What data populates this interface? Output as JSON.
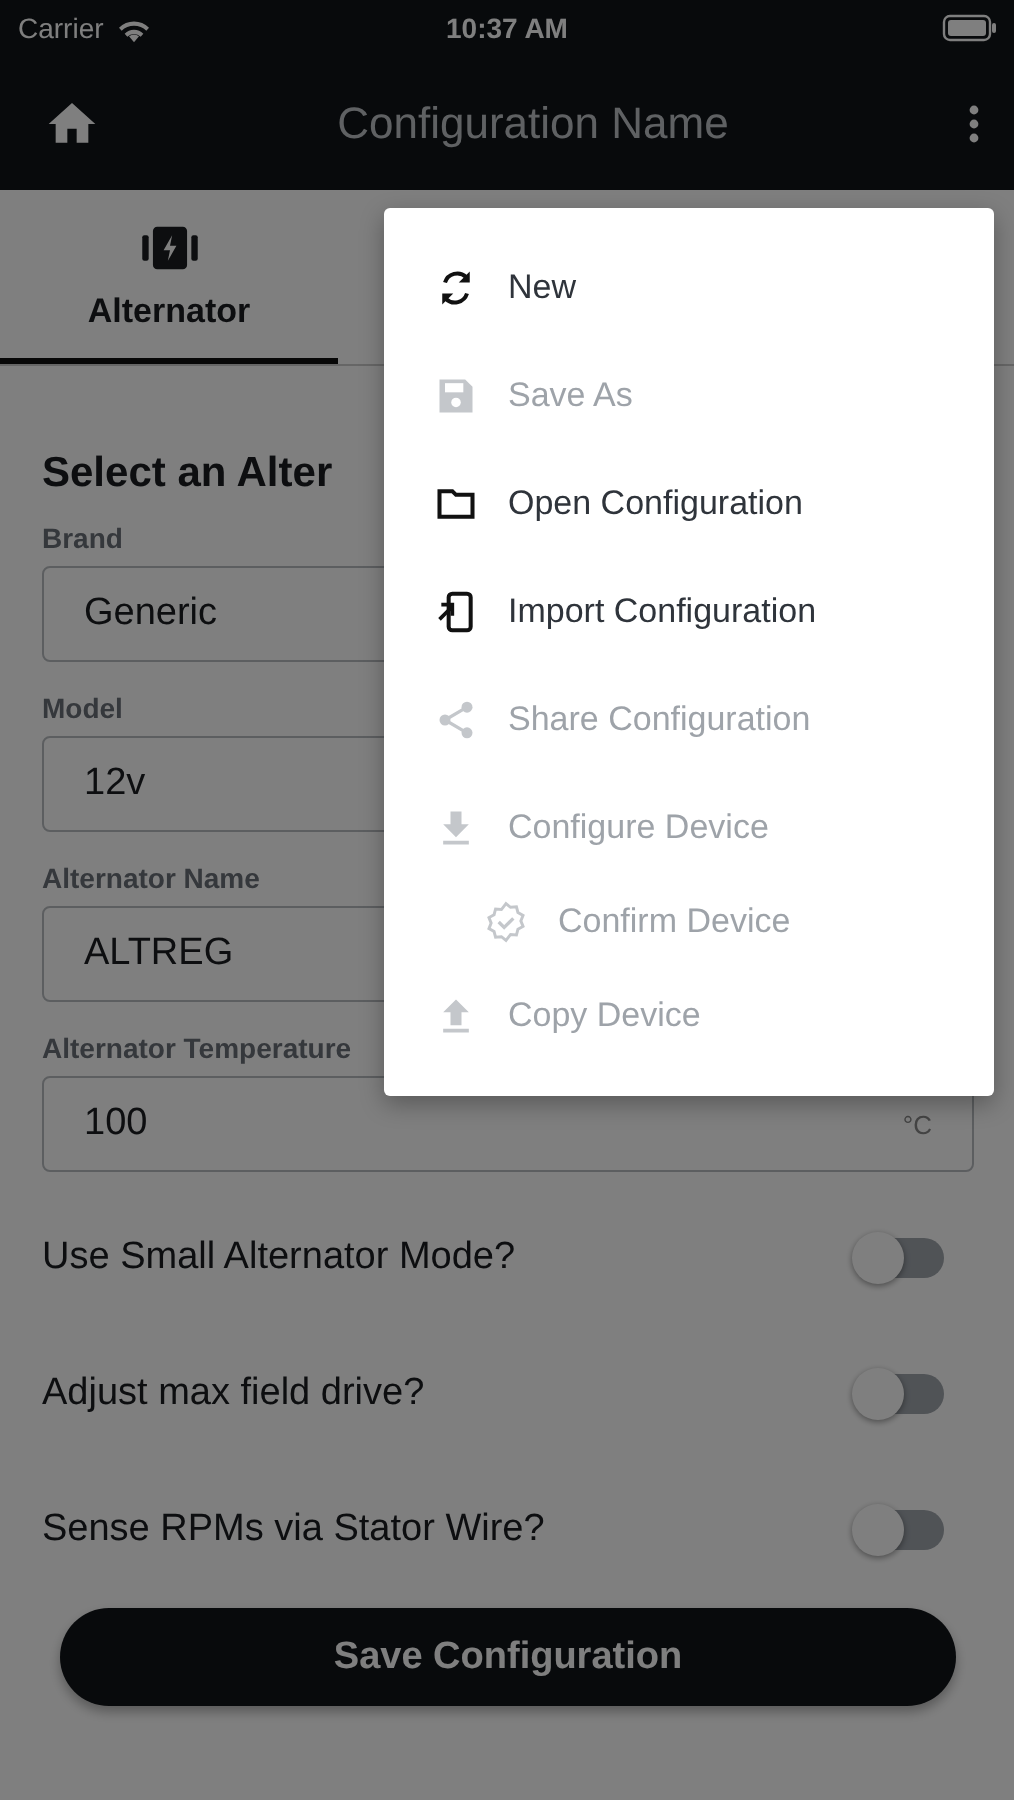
{
  "status_bar": {
    "carrier": "Carrier",
    "time": "10:37 AM"
  },
  "nav": {
    "title": "Configuration Name"
  },
  "tabs": [
    {
      "label": "Alternator",
      "selected": true
    }
  ],
  "section_title": "Select an Alter",
  "fields": [
    {
      "label": "Brand",
      "value": "Generic"
    },
    {
      "label": "Model",
      "value": "12v"
    },
    {
      "label": "Alternator Name",
      "value": "ALTREG"
    },
    {
      "label": "Alternator Temperature",
      "value": "100",
      "unit": "°C"
    }
  ],
  "toggles": [
    {
      "label": "Use Small Alternator Mode?",
      "on": false
    },
    {
      "label": "Adjust max field drive?",
      "on": false
    },
    {
      "label": "Sense RPMs via Stator Wire?",
      "on": false
    }
  ],
  "save_button": "Save Configuration",
  "menu": {
    "items": [
      {
        "label": "New",
        "disabled": false
      },
      {
        "label": "Save As",
        "disabled": true
      },
      {
        "label": "Open Configuration",
        "disabled": false
      },
      {
        "label": "Import Configuration",
        "disabled": false
      },
      {
        "label": "Share Configuration",
        "disabled": true
      },
      {
        "label": "Configure Device",
        "disabled": true,
        "children": [
          {
            "label": "Confirm Device",
            "disabled": true
          }
        ]
      },
      {
        "label": "Copy Device",
        "disabled": true
      }
    ]
  }
}
